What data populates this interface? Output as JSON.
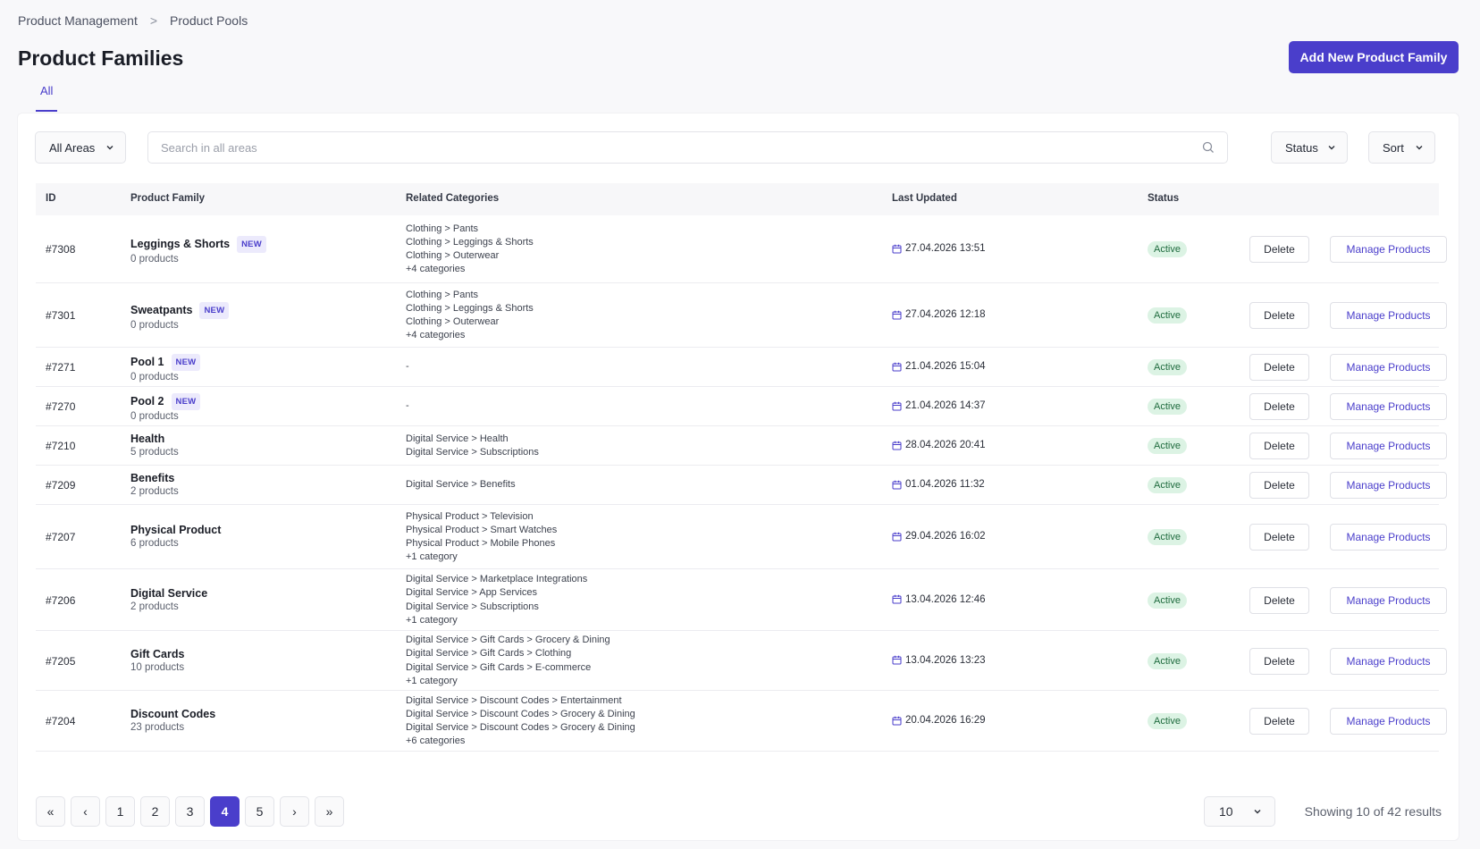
{
  "breadcrumb": {
    "items": [
      "Product Management",
      "Product Pools"
    ],
    "separator": ">"
  },
  "page": {
    "title": "Product Families",
    "add_button": "Add New Product Family"
  },
  "tabs": [
    {
      "label": "All",
      "active": true
    }
  ],
  "filters": {
    "area": "All Areas",
    "search_placeholder": "Search in all areas",
    "status": "Status",
    "sort": "Sort"
  },
  "table": {
    "headers": {
      "id": "ID",
      "family": "Product Family",
      "categories": "Related Categories",
      "updated": "Last Updated",
      "status": "Status"
    },
    "action_delete": "Delete",
    "action_manage": "Manage Products",
    "new_badge": "NEW",
    "rows": [
      {
        "id": "#7308",
        "name": "Leggings & Shorts",
        "is_new": true,
        "count": "0 products",
        "categories": [
          "Clothing > Pants",
          "Clothing > Leggings & Shorts",
          "Clothing > Outerwear",
          "+4 categories"
        ],
        "updated": "27.04.2026 13:51",
        "status": "Active"
      },
      {
        "id": "#7301",
        "name": "Sweatpants",
        "is_new": true,
        "count": "0 products",
        "categories": [
          "Clothing > Pants",
          "Clothing > Leggings & Shorts",
          "Clothing > Outerwear",
          "+4 categories"
        ],
        "updated": "27.04.2026 12:18",
        "status": "Active"
      },
      {
        "id": "#7271",
        "name": "Pool 1",
        "is_new": true,
        "count": "0 products",
        "categories": [
          "-"
        ],
        "updated": "21.04.2026 15:04",
        "status": "Active"
      },
      {
        "id": "#7270",
        "name": "Pool 2",
        "is_new": true,
        "count": "0 products",
        "categories": [
          "-"
        ],
        "updated": "21.04.2026 14:37",
        "status": "Active"
      },
      {
        "id": "#7210",
        "name": "Health",
        "is_new": false,
        "count": "5 products",
        "categories": [
          "Digital Service > Health",
          "Digital Service > Subscriptions"
        ],
        "updated": "28.04.2026 20:41",
        "status": "Active"
      },
      {
        "id": "#7209",
        "name": "Benefits",
        "is_new": false,
        "count": "2 products",
        "categories": [
          "Digital Service > Benefits"
        ],
        "updated": "01.04.2026 11:32",
        "status": "Active"
      },
      {
        "id": "#7207",
        "name": "Physical Product",
        "is_new": false,
        "count": "6 products",
        "categories": [
          "Physical Product > Television",
          "Physical Product > Smart Watches",
          "Physical Product > Mobile Phones",
          "+1 category"
        ],
        "updated": "29.04.2026 16:02",
        "status": "Active"
      },
      {
        "id": "#7206",
        "name": "Digital Service",
        "is_new": false,
        "count": "2 products",
        "categories": [
          "Digital Service > Marketplace Integrations",
          "Digital Service > App Services",
          "Digital Service > Subscriptions",
          "+1 category"
        ],
        "updated": "13.04.2026 12:46",
        "status": "Active"
      },
      {
        "id": "#7205",
        "name": "Gift Cards",
        "is_new": false,
        "count": "10 products",
        "categories": [
          "Digital Service > Gift Cards > Grocery & Dining",
          "Digital Service > Gift Cards > Clothing",
          "Digital Service > Gift Cards > E-commerce",
          "+1 category"
        ],
        "updated": "13.04.2026 13:23",
        "status": "Active"
      },
      {
        "id": "#7204",
        "name": "Discount Codes",
        "is_new": false,
        "count": "23 products",
        "categories": [
          "Digital Service > Discount Codes > Entertainment",
          "Digital Service > Discount Codes > Grocery & Dining",
          "Digital Service > Discount Codes > Grocery & Dining",
          "+6 categories"
        ],
        "updated": "20.04.2026 16:29",
        "status": "Active"
      }
    ]
  },
  "pagination": {
    "first": "«",
    "prev": "‹",
    "next": "›",
    "last": "»",
    "pages": [
      "1",
      "2",
      "3",
      "4",
      "5"
    ],
    "current": "4",
    "per_page": "10",
    "summary": "Showing 10 of 42 results"
  },
  "colors": {
    "accent": "#4a3ecb",
    "status_active_bg": "#dcf3e4",
    "status_active_text": "#1f6b3e"
  }
}
